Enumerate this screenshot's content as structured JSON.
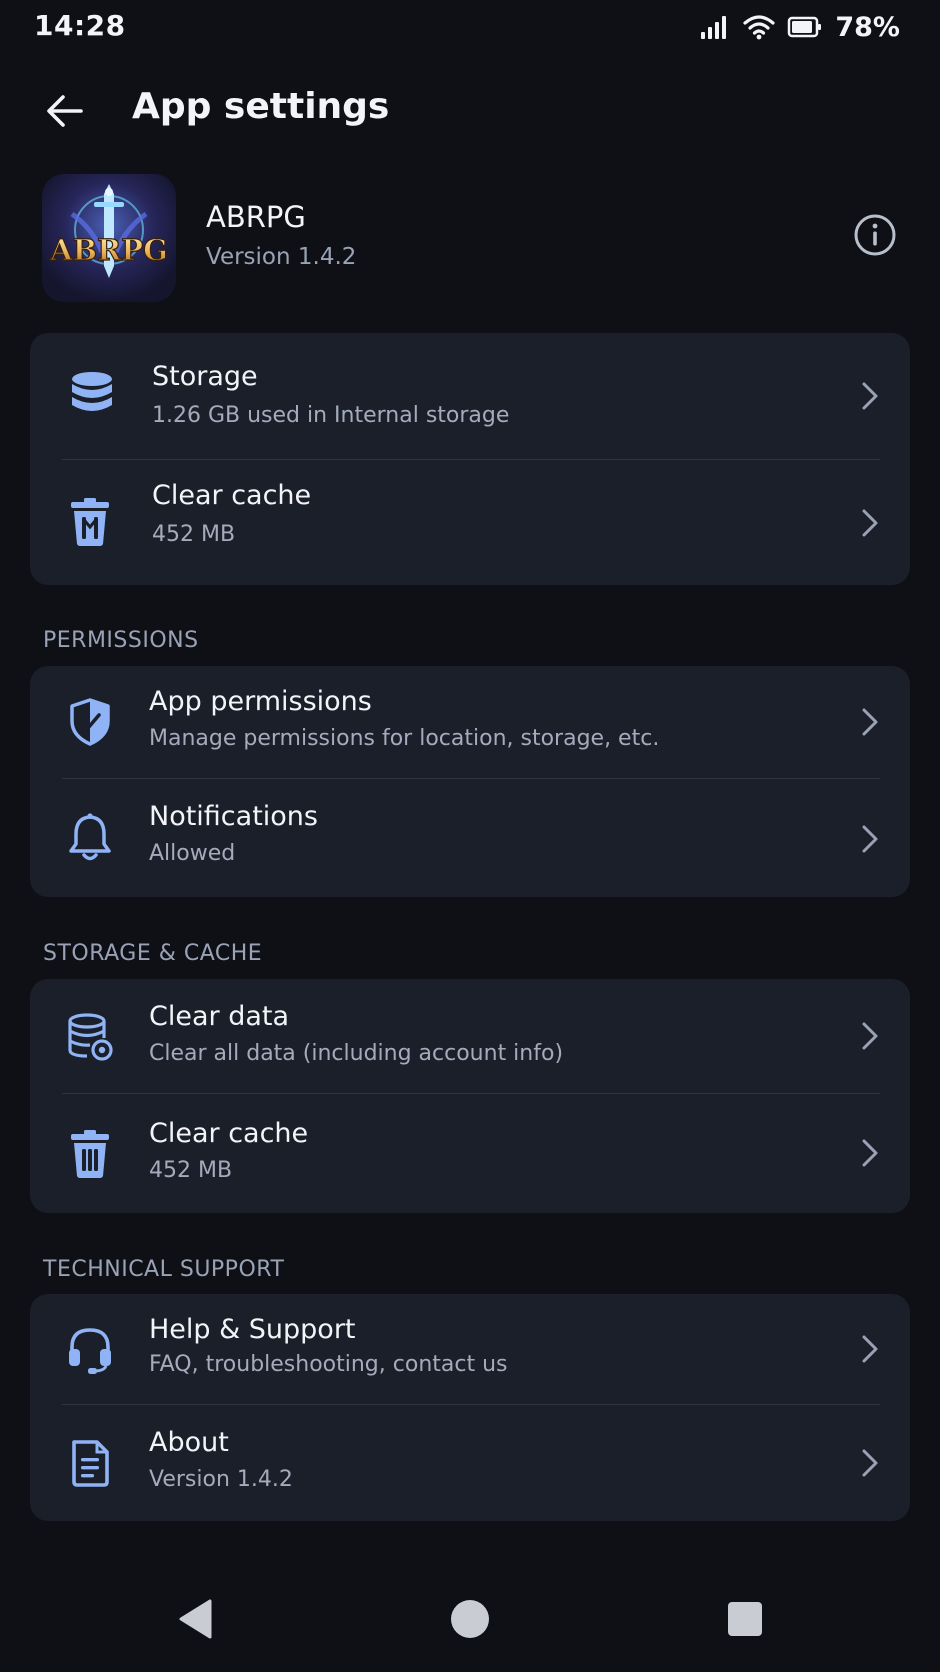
{
  "status_bar": {
    "time": "14:28",
    "battery_percent": "78%",
    "icons": [
      "signal-icon",
      "wifi-icon",
      "battery-icon"
    ]
  },
  "header": {
    "title": "App settings",
    "back_icon": "arrow-left-icon"
  },
  "app": {
    "name": "ABRPG",
    "version": "Version 1.4.2",
    "logo_text": "ABRPG",
    "info_icon": "info-icon"
  },
  "top_card": {
    "rows": [
      {
        "title": "Storage",
        "subtitle": "1.26 GB used in Internal storage",
        "icon": "database-icon"
      },
      {
        "title": "Clear cache",
        "subtitle": "452 MB",
        "icon": "trash-icon"
      }
    ]
  },
  "sections": [
    {
      "label": "PERMISSIONS",
      "rows": [
        {
          "title": "App permissions",
          "subtitle": "Manage permissions for location, storage, etc.",
          "icon": "shield-icon"
        },
        {
          "title": "Notifications",
          "subtitle": "Allowed",
          "icon": "bell-icon"
        }
      ]
    },
    {
      "label": "STORAGE & CACHE",
      "rows": [
        {
          "title": "Clear data",
          "subtitle": "Clear all data (including account info)",
          "icon": "database-clear-icon"
        },
        {
          "title": "Clear cache",
          "subtitle": "452 MB",
          "icon": "trash-icon"
        }
      ]
    },
    {
      "label": "TECHNICAL SUPPORT",
      "rows": [
        {
          "title": "Help & Support",
          "subtitle": "FAQ, troubleshooting, contact us",
          "icon": "headset-icon"
        },
        {
          "title": "About",
          "subtitle": "Version 1.4.2",
          "icon": "document-icon"
        }
      ]
    }
  ],
  "nav_bar": {
    "buttons": [
      "nav-back-icon",
      "nav-home-icon",
      "nav-recents-icon"
    ]
  },
  "colors": {
    "background": "#0e1016",
    "card": "#1b1f29",
    "icon_accent": "#8fb3f5",
    "text_primary": "#f2f4f8",
    "text_secondary": "#a3abbc"
  }
}
